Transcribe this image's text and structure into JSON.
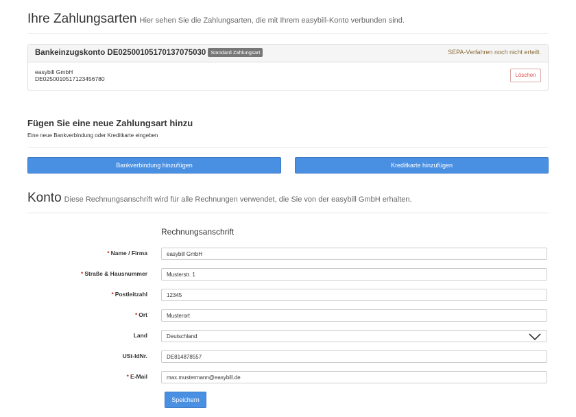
{
  "payment": {
    "title": "Ihre Zahlungsarten",
    "subtitle": "Hier sehen Sie die Zahlungsarten, die mit Ihrem easybill-Konto verbunden sind.",
    "account_title": "Bankeinzugskonto DE02500105170137075030",
    "badge": "Standard Zahlungsart",
    "sepa_status": "SEPA-Verfahren noch nicht erteilt.",
    "holder": "easybill GmbH",
    "iban": "DE0250010517123456780",
    "delete_label": "Löschen"
  },
  "add": {
    "title": "Fügen Sie eine neue Zahlungsart hinzu",
    "subtitle": "Eine neue Bankverbindung oder Kreditkarte eingeben",
    "bank_button": "Bankverbindung hinzufügen",
    "card_button": "Kreditkarte hinzufügen"
  },
  "konto": {
    "title": "Konto",
    "subtitle": "Diese Rechnungsanschrift wird für alle Rechnungen verwendet, die Sie von der easybill GmbH erhalten.",
    "section_title": "Rechnungsanschrift",
    "fields": {
      "name": {
        "label": "Name / Firma",
        "value": "easybill GmbH",
        "required": "*"
      },
      "street": {
        "label": "Straße & Hausnummer",
        "value": "Musterstr. 1",
        "required": "*"
      },
      "zip": {
        "label": "Postleitzahl",
        "value": "12345",
        "required": "*"
      },
      "city": {
        "label": "Ort",
        "value": "Musterort",
        "required": "*"
      },
      "country": {
        "label": "Land",
        "value": "Deutschland"
      },
      "vat": {
        "label": "USt-IdNr.",
        "value": "DE814878557"
      },
      "email": {
        "label": "E-Mail",
        "value": "max.mustermann@easybill.de",
        "required": "*"
      }
    },
    "save_label": "Speichern"
  },
  "colors": {
    "accent": "#4a90e2",
    "danger": "#d9534f",
    "warning": "#8a6d3b",
    "badge": "#777777"
  },
  "icons": {
    "select": "chevron-down-icon"
  }
}
